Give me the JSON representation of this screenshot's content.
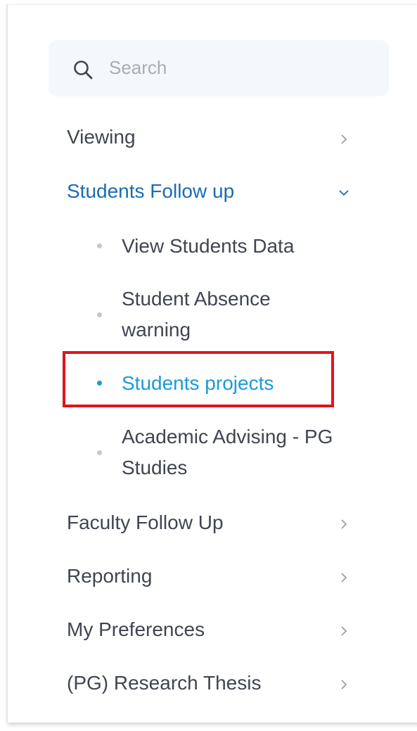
{
  "search": {
    "placeholder": "Search",
    "icon": "search-icon"
  },
  "menu": {
    "viewing": "Viewing",
    "students_follow_up": "Students Follow up",
    "students_sub": {
      "view_students_data": "View Students Data",
      "absence_line1": "Student Absence",
      "absence_line2": "warning",
      "students_projects": "Students projects",
      "advising_line1": "Academic Advising - PG",
      "advising_line2": "Studies"
    },
    "faculty_follow_up": "Faculty Follow Up",
    "reporting": "Reporting",
    "my_preferences": "My Preferences",
    "research_thesis": "(PG) Research Thesis"
  },
  "colors": {
    "active_group": "#1a6bb5",
    "current_item": "#1b9ad8",
    "highlight_border": "#e0141a",
    "text": "#3f4551"
  }
}
